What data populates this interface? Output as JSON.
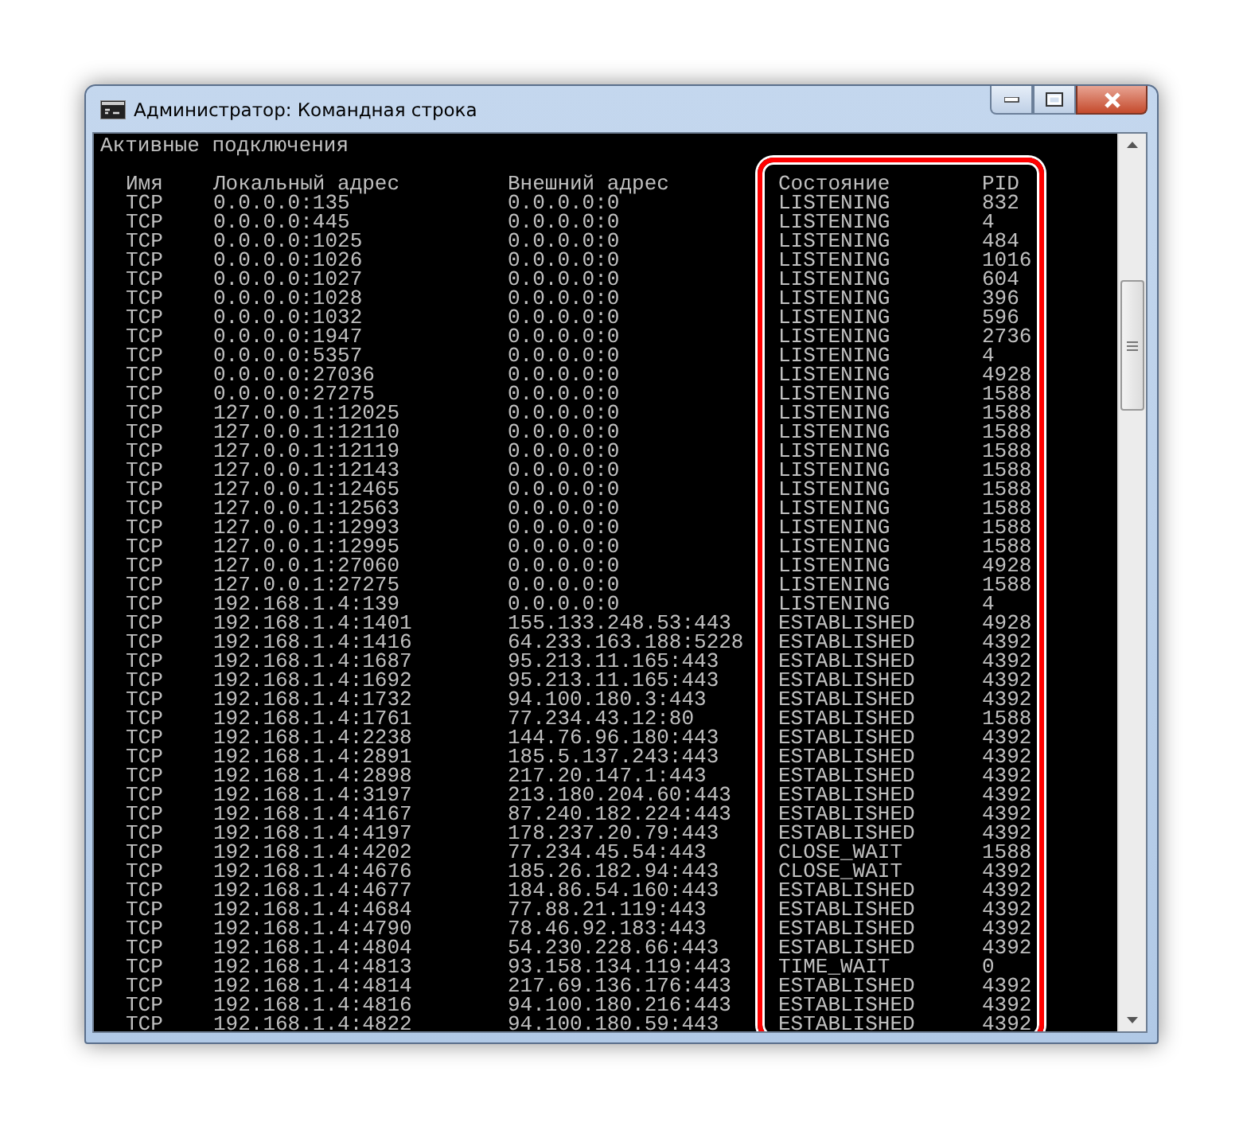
{
  "window": {
    "title": "Администратор: Командная строка"
  },
  "console": {
    "heading": "Активные подключения",
    "columns": [
      {
        "label": "Имя",
        "highlighted": false
      },
      {
        "label": "Локальный адрес",
        "highlighted": false
      },
      {
        "label": "Внешний адрес",
        "highlighted": false
      },
      {
        "label": "Состояние",
        "highlighted": true
      },
      {
        "label": "PID",
        "highlighted": true
      }
    ],
    "rows": [
      [
        "TCP",
        "0.0.0.0:135",
        "0.0.0.0:0",
        "LISTENING",
        "832"
      ],
      [
        "TCP",
        "0.0.0.0:445",
        "0.0.0.0:0",
        "LISTENING",
        "4"
      ],
      [
        "TCP",
        "0.0.0.0:1025",
        "0.0.0.0:0",
        "LISTENING",
        "484"
      ],
      [
        "TCP",
        "0.0.0.0:1026",
        "0.0.0.0:0",
        "LISTENING",
        "1016"
      ],
      [
        "TCP",
        "0.0.0.0:1027",
        "0.0.0.0:0",
        "LISTENING",
        "604"
      ],
      [
        "TCP",
        "0.0.0.0:1028",
        "0.0.0.0:0",
        "LISTENING",
        "396"
      ],
      [
        "TCP",
        "0.0.0.0:1032",
        "0.0.0.0:0",
        "LISTENING",
        "596"
      ],
      [
        "TCP",
        "0.0.0.0:1947",
        "0.0.0.0:0",
        "LISTENING",
        "2736"
      ],
      [
        "TCP",
        "0.0.0.0:5357",
        "0.0.0.0:0",
        "LISTENING",
        "4"
      ],
      [
        "TCP",
        "0.0.0.0:27036",
        "0.0.0.0:0",
        "LISTENING",
        "4928"
      ],
      [
        "TCP",
        "0.0.0.0:27275",
        "0.0.0.0:0",
        "LISTENING",
        "1588"
      ],
      [
        "TCP",
        "127.0.0.1:12025",
        "0.0.0.0:0",
        "LISTENING",
        "1588"
      ],
      [
        "TCP",
        "127.0.0.1:12110",
        "0.0.0.0:0",
        "LISTENING",
        "1588"
      ],
      [
        "TCP",
        "127.0.0.1:12119",
        "0.0.0.0:0",
        "LISTENING",
        "1588"
      ],
      [
        "TCP",
        "127.0.0.1:12143",
        "0.0.0.0:0",
        "LISTENING",
        "1588"
      ],
      [
        "TCP",
        "127.0.0.1:12465",
        "0.0.0.0:0",
        "LISTENING",
        "1588"
      ],
      [
        "TCP",
        "127.0.0.1:12563",
        "0.0.0.0:0",
        "LISTENING",
        "1588"
      ],
      [
        "TCP",
        "127.0.0.1:12993",
        "0.0.0.0:0",
        "LISTENING",
        "1588"
      ],
      [
        "TCP",
        "127.0.0.1:12995",
        "0.0.0.0:0",
        "LISTENING",
        "1588"
      ],
      [
        "TCP",
        "127.0.0.1:27060",
        "0.0.0.0:0",
        "LISTENING",
        "4928"
      ],
      [
        "TCP",
        "127.0.0.1:27275",
        "0.0.0.0:0",
        "LISTENING",
        "1588"
      ],
      [
        "TCP",
        "192.168.1.4:139",
        "0.0.0.0:0",
        "LISTENING",
        "4"
      ],
      [
        "TCP",
        "192.168.1.4:1401",
        "155.133.248.53:443",
        "ESTABLISHED",
        "4928"
      ],
      [
        "TCP",
        "192.168.1.4:1416",
        "64.233.163.188:5228",
        "ESTABLISHED",
        "4392"
      ],
      [
        "TCP",
        "192.168.1.4:1687",
        "95.213.11.165:443",
        "ESTABLISHED",
        "4392"
      ],
      [
        "TCP",
        "192.168.1.4:1692",
        "95.213.11.165:443",
        "ESTABLISHED",
        "4392"
      ],
      [
        "TCP",
        "192.168.1.4:1732",
        "94.100.180.3:443",
        "ESTABLISHED",
        "4392"
      ],
      [
        "TCP",
        "192.168.1.4:1761",
        "77.234.43.12:80",
        "ESTABLISHED",
        "1588"
      ],
      [
        "TCP",
        "192.168.1.4:2238",
        "144.76.96.180:443",
        "ESTABLISHED",
        "4392"
      ],
      [
        "TCP",
        "192.168.1.4:2891",
        "185.5.137.243:443",
        "ESTABLISHED",
        "4392"
      ],
      [
        "TCP",
        "192.168.1.4:2898",
        "217.20.147.1:443",
        "ESTABLISHED",
        "4392"
      ],
      [
        "TCP",
        "192.168.1.4:3197",
        "213.180.204.60:443",
        "ESTABLISHED",
        "4392"
      ],
      [
        "TCP",
        "192.168.1.4:4167",
        "87.240.182.224:443",
        "ESTABLISHED",
        "4392"
      ],
      [
        "TCP",
        "192.168.1.4:4197",
        "178.237.20.79:443",
        "ESTABLISHED",
        "4392"
      ],
      [
        "TCP",
        "192.168.1.4:4202",
        "77.234.45.54:443",
        "CLOSE_WAIT",
        "1588"
      ],
      [
        "TCP",
        "192.168.1.4:4676",
        "185.26.182.94:443",
        "CLOSE_WAIT",
        "4392"
      ],
      [
        "TCP",
        "192.168.1.4:4677",
        "184.86.54.160:443",
        "ESTABLISHED",
        "4392"
      ],
      [
        "TCP",
        "192.168.1.4:4684",
        "77.88.21.119:443",
        "ESTABLISHED",
        "4392"
      ],
      [
        "TCP",
        "192.168.1.4:4790",
        "78.46.92.183:443",
        "ESTABLISHED",
        "4392"
      ],
      [
        "TCP",
        "192.168.1.4:4804",
        "54.230.228.66:443",
        "ESTABLISHED",
        "4392"
      ],
      [
        "TCP",
        "192.168.1.4:4813",
        "93.158.134.119:443",
        "TIME_WAIT",
        "0"
      ],
      [
        "TCP",
        "192.168.1.4:4814",
        "217.69.136.176:443",
        "ESTABLISHED",
        "4392"
      ],
      [
        "TCP",
        "192.168.1.4:4816",
        "94.100.180.216:443",
        "ESTABLISHED",
        "4392"
      ],
      [
        "TCP",
        "192.168.1.4:4822",
        "94.100.180.59:443",
        "ESTABLISHED",
        "4392"
      ]
    ]
  }
}
